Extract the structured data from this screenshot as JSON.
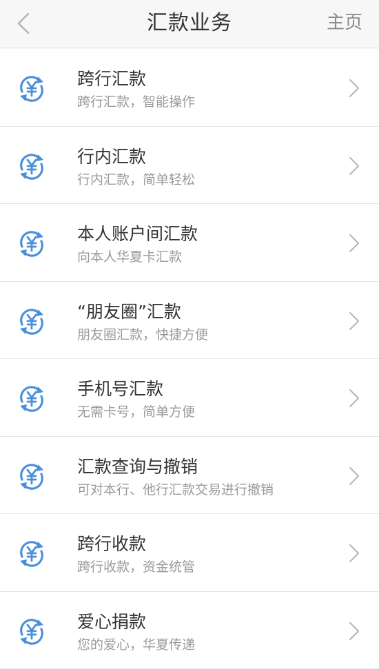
{
  "header": {
    "back_icon": "chevron-left-icon",
    "title": "汇款业务",
    "home_label": "主页"
  },
  "colors": {
    "accent": "#4a90d9",
    "title_text": "#333333",
    "subtitle_text": "#9a9a9a",
    "chevron": "#b4b4b4",
    "background": "#f7f7f7"
  },
  "items": [
    {
      "icon": "yuan-exchange-icon",
      "title": "跨行汇款",
      "subtitle": "跨行汇款，智能操作"
    },
    {
      "icon": "yuan-exchange-icon",
      "title": "行内汇款",
      "subtitle": "行内汇款，简单轻松"
    },
    {
      "icon": "yuan-exchange-icon",
      "title": "本人账户间汇款",
      "subtitle": "向本人华夏卡汇款"
    },
    {
      "icon": "yuan-exchange-icon",
      "title": "“朋友圈”汇款",
      "subtitle": "朋友圈汇款，快捷方便"
    },
    {
      "icon": "yuan-exchange-icon",
      "title": "手机号汇款",
      "subtitle": "无需卡号，简单方便"
    },
    {
      "icon": "yuan-exchange-icon",
      "title": "汇款查询与撤销",
      "subtitle": "可对本行、他行汇款交易进行撤销"
    },
    {
      "icon": "yuan-exchange-icon",
      "title": "跨行收款",
      "subtitle": "跨行收款，资金统管"
    },
    {
      "icon": "yuan-exchange-icon",
      "title": "爱心捐款",
      "subtitle": "您的爱心，华夏传递"
    }
  ]
}
